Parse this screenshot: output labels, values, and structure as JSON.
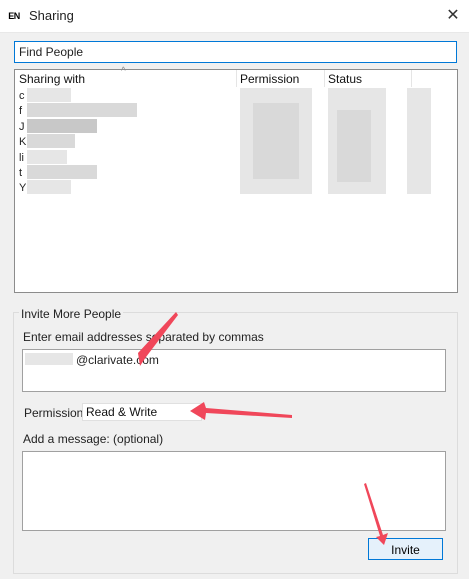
{
  "window": {
    "icon_text": "EN",
    "title": "Sharing",
    "close_glyph": "✕"
  },
  "find": {
    "value": "Find People"
  },
  "list": {
    "columns": [
      "Sharing with",
      "Permission",
      "Status"
    ],
    "sort_glyph": "^",
    "row_initials": [
      "c",
      "f",
      "J",
      "K",
      "li",
      "t",
      "Y"
    ]
  },
  "invite": {
    "group_title": "Invite More People",
    "email_label": "Enter email addresses separated by commas",
    "email_value": "@clarivate.com",
    "permission_label": "Permission:",
    "permission_value": "Read & Write",
    "message_label": "Add a message: (optional)",
    "invite_label": "Invite"
  },
  "colors": {
    "accent": "#0078d7",
    "annotation": "#f0475a"
  }
}
